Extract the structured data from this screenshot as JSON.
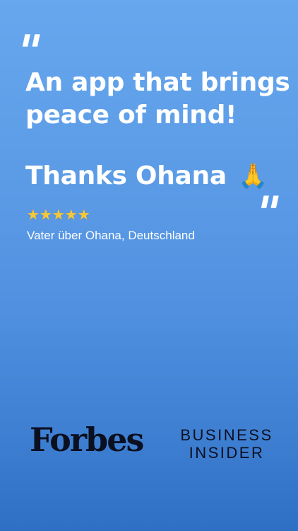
{
  "quote": {
    "open_mark": "“",
    "close_mark": "”",
    "headline": "An app that brings peace of mind!",
    "thanks": "Thanks Ohana",
    "emoji": "🙏"
  },
  "rating": {
    "stars": "★★★★★",
    "value": 5,
    "max": 5
  },
  "attribution": "Vater über Ohana, Deutschland",
  "press": {
    "forbes": "Forbes",
    "business_insider_line1": "BUSINESS",
    "business_insider_line2": "INSIDER"
  }
}
